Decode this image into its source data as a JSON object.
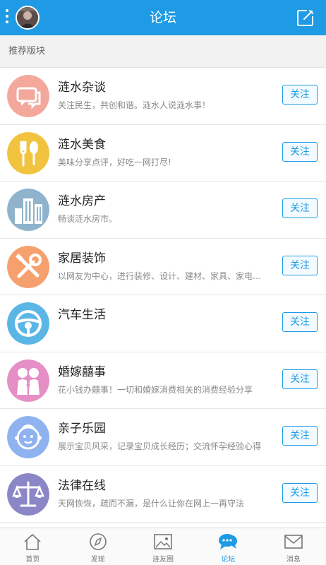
{
  "header": {
    "title": "论坛",
    "menu_icon": "vertical-dots-icon",
    "compose_icon": "compose-icon"
  },
  "section": {
    "label": "推荐版块"
  },
  "forums": [
    {
      "name": "涟水杂谈",
      "desc": "关注民生，共创和谐。涟水人说涟水事！",
      "follow": "关注",
      "icon": "chat-bubbles-icon",
      "color": "#f4a79b"
    },
    {
      "name": "涟水美食",
      "desc": "美味分享点评，好吃一网打尽!",
      "follow": "关注",
      "icon": "fork-spoon-icon",
      "color": "#f2c33f"
    },
    {
      "name": "涟水房产",
      "desc": "畅谈涟水房市。",
      "follow": "关注",
      "icon": "buildings-icon",
      "color": "#8fb3cc"
    },
    {
      "name": "家居装饰",
      "desc": "以网友为中心，进行装修、设计、建材、家具、家电等选购指导",
      "follow": "关注",
      "icon": "tools-icon",
      "color": "#f6a06e"
    },
    {
      "name": "汽车生活",
      "desc": "",
      "follow": "关注",
      "icon": "steering-wheel-icon",
      "color": "#5bb6e6"
    },
    {
      "name": "婚嫁囍事",
      "desc": "花小钱办囍事！一切和婚嫁消费相关的消费经验分享",
      "follow": "关注",
      "icon": "couple-icon",
      "color": "#e58fc6"
    },
    {
      "name": "亲子乐园",
      "desc": "展示宝贝风采，记录宝贝成长经历；交流怀孕经验心得",
      "follow": "关注",
      "icon": "baby-face-icon",
      "color": "#8fb2f1"
    },
    {
      "name": "法律在线",
      "desc": "天网恢恢，疏而不漏，是什么让你在网上一再守法",
      "follow": "关注",
      "icon": "scales-icon",
      "color": "#8b87c6"
    }
  ],
  "tabs": [
    {
      "label": "首页",
      "icon": "home-icon",
      "active": false
    },
    {
      "label": "发现",
      "icon": "compass-icon",
      "active": false
    },
    {
      "label": "涟友圈",
      "icon": "image-icon",
      "active": false
    },
    {
      "label": "论坛",
      "icon": "speech-bubble-icon",
      "active": true
    },
    {
      "label": "消息",
      "icon": "envelope-icon",
      "active": false
    }
  ],
  "colors": {
    "accent": "#1e9be4",
    "header_bg": "#1e9be4",
    "section_bg": "#f2f2f2"
  }
}
